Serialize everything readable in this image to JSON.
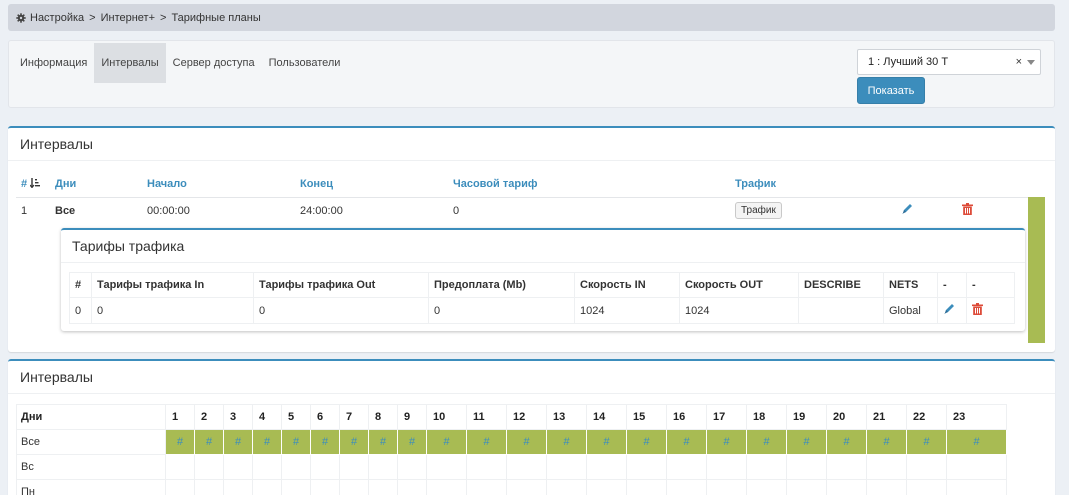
{
  "breadcrumb": {
    "icon": "gear-icon",
    "items": [
      "Настройка",
      "Интернет+",
      "Тарифные планы"
    ],
    "separator": ">"
  },
  "tabs": [
    {
      "label": "Информация",
      "active": false
    },
    {
      "label": "Интервалы",
      "active": true
    },
    {
      "label": "Сервер доступа",
      "active": false
    },
    {
      "label": "Пользователи",
      "active": false
    }
  ],
  "tariff_select": {
    "value": "1 : Лучший 30 Т",
    "clear": "×"
  },
  "show_button": "Показать",
  "intervals_box": {
    "title": "Интервалы",
    "columns": [
      "#",
      "Дни",
      "Начало",
      "Конец",
      "Часовой тариф",
      "Трафик"
    ],
    "row": {
      "num": "1",
      "days": "Все",
      "start": "00:00:00",
      "end": "24:00:00",
      "hour_tariff": "0",
      "traffic_button": "Трафик"
    }
  },
  "traffic_box": {
    "title": "Тарифы трафика",
    "columns": [
      "#",
      "Тарифы трафика In",
      "Тарифы трафика Out",
      "Предоплата (Mb)",
      "Скорость IN",
      "Скорость OUT",
      "DESCRIBE",
      "NETS",
      "-",
      "-"
    ],
    "row": {
      "num": "0",
      "in": "0",
      "out": "0",
      "prepaid": "0",
      "speed_in": "1024",
      "speed_out": "1024",
      "describe": "",
      "nets": "Global"
    }
  },
  "schedule_box": {
    "title": "Интервалы",
    "days_header": "Дни",
    "hours": [
      "1",
      "2",
      "3",
      "4",
      "5",
      "6",
      "7",
      "8",
      "9",
      "10",
      "11",
      "12",
      "13",
      "14",
      "15",
      "16",
      "17",
      "18",
      "19",
      "20",
      "21",
      "22",
      "23"
    ],
    "days": [
      "Все",
      "Вс",
      "Пн"
    ],
    "cell_mark": "#"
  },
  "colors": {
    "accent": "#3c8dbc",
    "green": "#a8bb53",
    "danger": "#dd4b39"
  }
}
